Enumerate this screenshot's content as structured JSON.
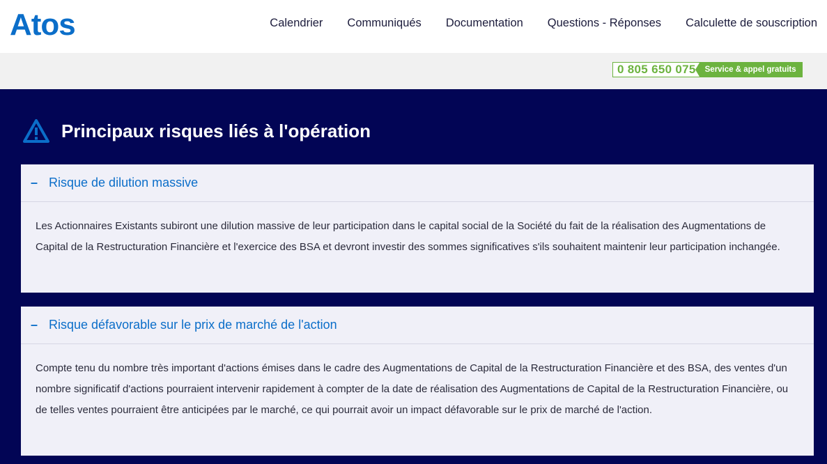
{
  "header": {
    "logo_text": "Atos",
    "nav": [
      {
        "label": "Calendrier"
      },
      {
        "label": "Communiqués"
      },
      {
        "label": "Documentation"
      },
      {
        "label": "Questions - Réponses"
      },
      {
        "label": "Calculette de souscription"
      }
    ]
  },
  "hotline": {
    "number": "0 805 650 075",
    "tag": "Service & appel gratuits",
    "color": "#6cb33f"
  },
  "section": {
    "icon": "warning-icon",
    "title": "Principaux risques liés à l'opération"
  },
  "accordions": [
    {
      "toggle": "–",
      "title": "Risque de dilution massive",
      "body": "Les Actionnaires Existants subiront une dilution massive de leur participation dans le capital social de la Société du fait de la réalisation des Augmentations de Capital de la Restructuration Financière et l'exercice des BSA et devront investir des sommes significatives s'ils souhaitent maintenir leur participation inchangée."
    },
    {
      "toggle": "–",
      "title": "Risque défavorable sur le prix de marché de l'action",
      "body": "Compte tenu du nombre très important d'actions émises dans le cadre des Augmentations de Capital de la Restructuration Financière et des BSA, des ventes d'un nombre significatif d'actions pourraient intervenir rapidement à compter de la date de réalisation des Augmentations de Capital de la Restructuration Financière, ou de telles ventes pourraient être anticipées par le marché, ce qui pourrait avoir un impact défavorable sur le prix de marché de l'action."
    }
  ],
  "colors": {
    "brand_blue": "#0b6ec9",
    "main_bg": "#020555",
    "accordion_bg": "#f0f0f8"
  }
}
